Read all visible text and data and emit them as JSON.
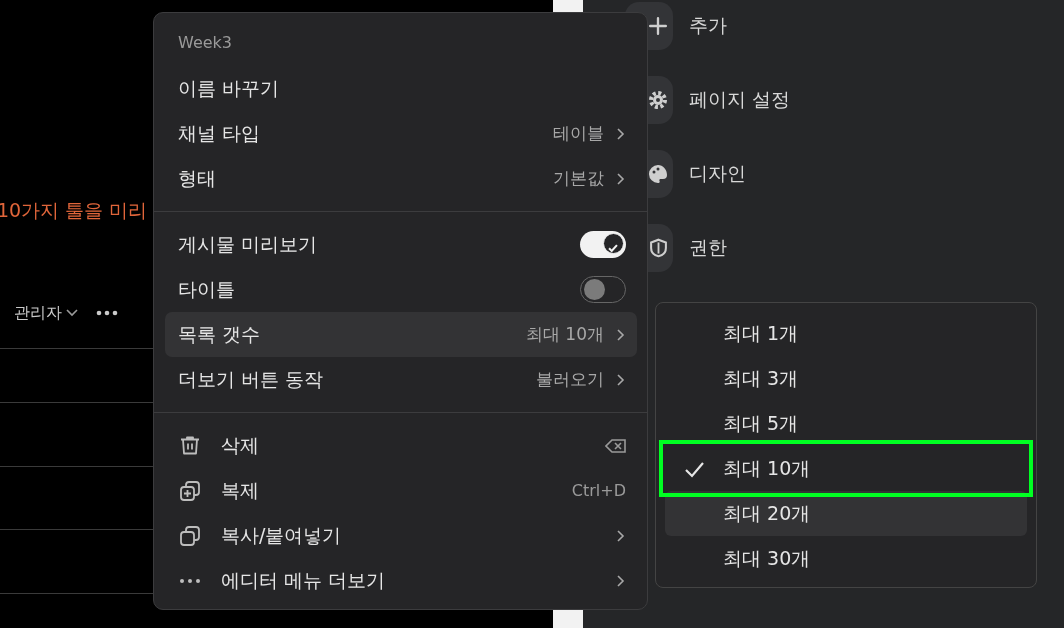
{
  "page": {
    "banner": "10가지 툴을 미리",
    "user_menu": "관리자"
  },
  "sidebar": {
    "items": [
      {
        "label": "추가"
      },
      {
        "label": "페이지 설정"
      },
      {
        "label": "디자인"
      },
      {
        "label": "권한"
      }
    ]
  },
  "menu": {
    "title": "Week3",
    "sections": [
      [
        {
          "kind": "plain",
          "label": "이름 바꾸기"
        },
        {
          "kind": "submenu",
          "label": "채널 타입",
          "value": "테이블",
          "highlighted": false
        },
        {
          "kind": "submenu",
          "label": "형태",
          "value": "기본값",
          "highlighted": false
        }
      ],
      [
        {
          "kind": "toggle",
          "label": "게시물 미리보기",
          "on": true
        },
        {
          "kind": "toggle",
          "label": "타이틀",
          "on": false
        },
        {
          "kind": "submenu",
          "label": "목록 갯수",
          "value": "최대 10개",
          "highlighted": true
        },
        {
          "kind": "submenu",
          "label": "더보기 버튼 동작",
          "value": "불러오기",
          "highlighted": false
        }
      ],
      [
        {
          "kind": "action",
          "label": "삭제"
        },
        {
          "kind": "action",
          "label": "복제",
          "shortcut": "Ctrl+D"
        },
        {
          "kind": "action",
          "label": "복사/붙여넣기",
          "submenu": true
        },
        {
          "kind": "action",
          "label": "에디터 메뉴 더보기",
          "submenu": true
        }
      ]
    ]
  },
  "submenu": {
    "items": [
      {
        "label": "최대 1개",
        "selected": false,
        "highlighted": false,
        "outlined": false
      },
      {
        "label": "최대 3개",
        "selected": false,
        "highlighted": false,
        "outlined": false
      },
      {
        "label": "최대 5개",
        "selected": false,
        "highlighted": false,
        "outlined": false
      },
      {
        "label": "최대 10개",
        "selected": true,
        "highlighted": false,
        "outlined": true
      },
      {
        "label": "최대 20개",
        "selected": false,
        "highlighted": true,
        "outlined": false
      },
      {
        "label": "최대 30개",
        "selected": false,
        "highlighted": false,
        "outlined": false
      }
    ]
  }
}
